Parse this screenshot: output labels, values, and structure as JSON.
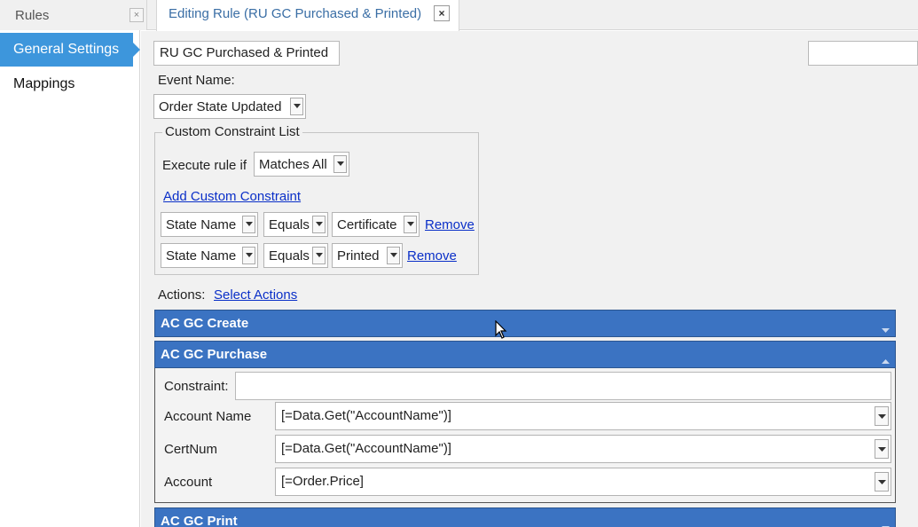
{
  "tabs": {
    "rules_label": "Rules",
    "rules_close": "×",
    "editing_label": "Editing Rule (RU GC Purchased & Printed)",
    "editing_close": "×"
  },
  "sidebar": {
    "items": [
      {
        "label": "General Settings",
        "active": true
      },
      {
        "label": "Mappings",
        "active": false
      }
    ]
  },
  "rule": {
    "name_value": "RU GC Purchased & Printed",
    "right_input_value": "",
    "event_name_label": "Event Name:",
    "event_name_value": "Order State Updated"
  },
  "constraints": {
    "legend": "Custom Constraint List",
    "execute_label": "Execute rule if",
    "execute_value": "Matches All",
    "add_link": "Add Custom Constraint",
    "rows": [
      {
        "field": "State Name",
        "operator": "Equals",
        "value": "Certificate",
        "remove": "Remove"
      },
      {
        "field": "State Name",
        "operator": "Equals",
        "value": "Printed",
        "remove": "Remove"
      }
    ]
  },
  "actions": {
    "label": "Actions:",
    "select_link": "Select Actions",
    "panels": [
      {
        "title": "AC GC Create",
        "expanded": false
      },
      {
        "title": "AC GC Purchase",
        "expanded": true
      },
      {
        "title": "AC GC Print",
        "expanded": false
      }
    ],
    "purchase": {
      "constraint_label": "Constraint:",
      "constraint_value": "",
      "fields": [
        {
          "label": "Account Name",
          "value": "[=Data.Get(\"AccountName\")]"
        },
        {
          "label": "CertNum",
          "value": "[=Data.Get(\"AccountName\")]"
        },
        {
          "label": "Account",
          "value": "[=Order.Price]"
        }
      ]
    }
  },
  "colors": {
    "sidebar_active": "#3d96dc",
    "panel_header": "#3b73c2",
    "link": "#0a2fc8",
    "tab_title": "#3a6ea5"
  }
}
